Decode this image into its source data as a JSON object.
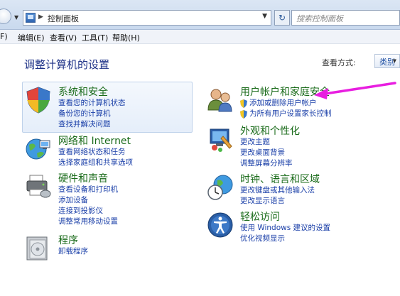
{
  "address_bar": {
    "path": "控制面板",
    "search_placeholder": "搜索控制面板",
    "refresh_glyph": "↻"
  },
  "menu": [
    "编辑(E)",
    "查看(V)",
    "工具(T)",
    "帮助(H)"
  ],
  "menu_partial": "F)",
  "page_title": "调整计算机的设置",
  "view": {
    "label": "查看方式:",
    "value": "类别"
  },
  "categories": [
    {
      "title": "系统和安全",
      "links": [
        "查看您的计算机状态",
        "备份您的计算机",
        "查找并解决问题"
      ]
    },
    {
      "title": "网络和 Internet",
      "links": [
        "查看网络状态和任务",
        "选择家庭组和共享选项"
      ]
    },
    {
      "title": "硬件和声音",
      "links": [
        "查看设备和打印机",
        "添加设备",
        "连接到投影仪",
        "调整常用移动设置"
      ]
    },
    {
      "title": "程序",
      "links": [
        "卸载程序"
      ]
    },
    {
      "title": "用户帐户和家庭安全",
      "links": [
        "添加或删除用户帐户",
        "为所有用户设置家长控制"
      ]
    },
    {
      "title": "外观和个性化",
      "links": [
        "更改主题",
        "更改桌面背景",
        "调整屏幕分辨率"
      ]
    },
    {
      "title": "时钟、语言和区域",
      "links": [
        "更改键盘或其他输入法",
        "更改显示语言"
      ]
    },
    {
      "title": "轻松访问",
      "links": [
        "使用 Windows 建议的设置",
        "优化视频显示"
      ]
    }
  ],
  "colors": {
    "title_green": "#1a6b1a",
    "link_blue": "#1a3fa8",
    "annotation_arrow": "#e81ee0"
  }
}
